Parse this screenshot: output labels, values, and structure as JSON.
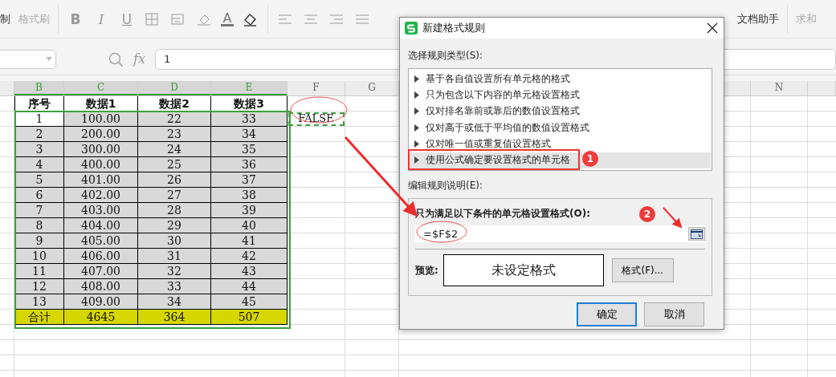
{
  "ribbon": {
    "left_items": [
      {
        "label": "制",
        "disabled": false
      },
      {
        "label": "格式刷",
        "disabled": true
      }
    ],
    "format_glyphs": [
      {
        "label": "B",
        "kind": "bold"
      },
      {
        "label": "I",
        "kind": "italic"
      },
      {
        "label": "U",
        "kind": "underline"
      }
    ],
    "font_color_glyph": "A",
    "right_items": [
      {
        "label": "文档助手",
        "disabled": false
      },
      {
        "label": "求和",
        "disabled": true
      }
    ]
  },
  "formula_bar": {
    "fx": "fx",
    "value": "1"
  },
  "sheet": {
    "columns": [
      {
        "label": "B",
        "selected": true
      },
      {
        "label": "C",
        "selected": true
      },
      {
        "label": "D",
        "selected": true
      },
      {
        "label": "E",
        "selected": true
      },
      {
        "label": "F",
        "selected": false
      },
      {
        "label": "G",
        "selected": false
      }
    ],
    "right_columns": [
      {
        "label": "N",
        "selected": false
      }
    ],
    "rows": [
      {
        "kind": "header",
        "cells": [
          "序号",
          "数据1",
          "数据2",
          "数据3"
        ]
      },
      {
        "kind": "data",
        "cells": [
          "1",
          "100.00",
          "22",
          "33"
        ],
        "active_first": true
      },
      {
        "kind": "data",
        "cells": [
          "2",
          "200.00",
          "23",
          "34"
        ],
        "active_first": false
      },
      {
        "kind": "data",
        "cells": [
          "3",
          "300.00",
          "24",
          "35"
        ],
        "active_first": false
      },
      {
        "kind": "data",
        "cells": [
          "4",
          "400.00",
          "25",
          "36"
        ],
        "active_first": false
      },
      {
        "kind": "data",
        "cells": [
          "5",
          "401.00",
          "26",
          "37"
        ],
        "active_first": false
      },
      {
        "kind": "data",
        "cells": [
          "6",
          "402.00",
          "27",
          "38"
        ],
        "active_first": false
      },
      {
        "kind": "data",
        "cells": [
          "7",
          "403.00",
          "28",
          "39"
        ],
        "active_first": false
      },
      {
        "kind": "data",
        "cells": [
          "8",
          "404.00",
          "29",
          "40"
        ],
        "active_first": false
      },
      {
        "kind": "data",
        "cells": [
          "9",
          "405.00",
          "30",
          "41"
        ],
        "active_first": false
      },
      {
        "kind": "data",
        "cells": [
          "10",
          "406.00",
          "31",
          "42"
        ],
        "active_first": false
      },
      {
        "kind": "data",
        "cells": [
          "11",
          "407.00",
          "32",
          "43"
        ],
        "active_first": false
      },
      {
        "kind": "data",
        "cells": [
          "12",
          "408.00",
          "33",
          "44"
        ],
        "active_first": false
      },
      {
        "kind": "data",
        "cells": [
          "13",
          "409.00",
          "34",
          "45"
        ],
        "active_first": false
      },
      {
        "kind": "total",
        "cells": [
          "合计",
          "4645",
          "364",
          "507"
        ]
      }
    ],
    "side_cell": "FALSE"
  },
  "dialog": {
    "title": "新建格式规则",
    "rule_type_label": "选择规则类型(S):",
    "rule_types": [
      {
        "label": "基于各自值设置所有单元格的格式",
        "selected": false
      },
      {
        "label": "只为包含以下内容的单元格设置格式",
        "selected": false
      },
      {
        "label": "仅对排名靠前或靠后的数值设置格式",
        "selected": false
      },
      {
        "label": "仅对高于或低于平均值的数值设置格式",
        "selected": false
      },
      {
        "label": "仅对唯一值或重复值设置格式",
        "selected": false
      },
      {
        "label": "使用公式确定要设置格式的单元格",
        "selected": true
      }
    ],
    "description_label": "编辑规则说明(E):",
    "condition_label": "只为满足以下条件的单元格设置格式(O):",
    "formula": "=$F$2",
    "preview_label": "预览:",
    "preview_text": "未设定格式",
    "format_button": "格式(F)...",
    "buttons": [
      {
        "label": "确定",
        "default": true
      },
      {
        "label": "取消",
        "default": false
      }
    ]
  },
  "annotations": {
    "badges": [
      "1",
      "2"
    ]
  }
}
